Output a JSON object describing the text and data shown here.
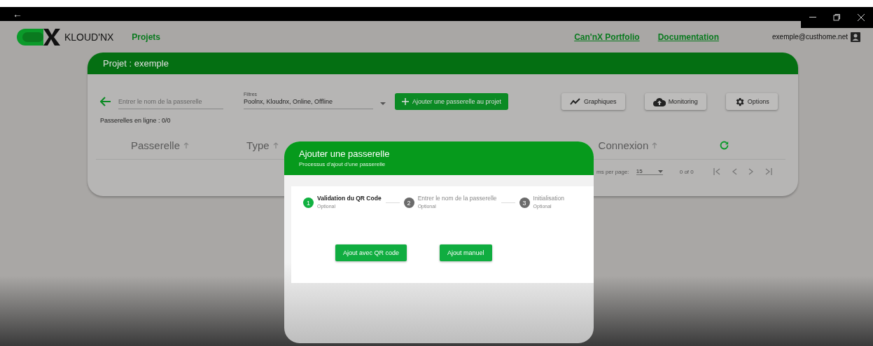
{
  "title_bar": {
    "back": "←"
  },
  "header": {
    "brand": "KLOUD'NX",
    "nav": [
      {
        "label": "Projets"
      }
    ],
    "links": [
      {
        "label": "Can'nX Portfolio"
      },
      {
        "label": "Documentation"
      }
    ],
    "user": "exemple@custhome.net"
  },
  "project": {
    "title": "Projet : exemple",
    "search": {
      "placeholder": "Entrer le nom de la passerelle"
    },
    "filter": {
      "label": "Filtres",
      "value": "Poolnx, Kloudnx, Online, Offline"
    },
    "add_button": "Ajouter une passerelle au projet",
    "tools": [
      {
        "label": "Graphiques",
        "kind": "chart"
      },
      {
        "label": "Monitoring",
        "kind": "cloud"
      },
      {
        "label": "Options",
        "kind": "gear"
      }
    ],
    "online": "Passerelles en ligne : 0/0",
    "columns": [
      {
        "label": "Passerelle"
      },
      {
        "label": "Type"
      },
      {
        "label": "Connexion"
      }
    ],
    "paginator": {
      "per_page_label": "ms per page:",
      "per_page": "15",
      "range": "0 of 0"
    }
  },
  "dialog": {
    "title": "Ajouter une passerelle",
    "subtitle": "Processus d'ajout d'une passerelle",
    "steps": [
      {
        "number": "1",
        "label": "Validation du QR Code",
        "hint": "Optional",
        "selected": true
      },
      {
        "number": "2",
        "label": "Entrer le nom de la passerelle",
        "hint": "Optional",
        "selected": false
      },
      {
        "number": "3",
        "label": "Initialisation",
        "hint": "Optional",
        "selected": false
      }
    ],
    "buttons": [
      "Ajout avec QR code",
      "Ajout manuel"
    ]
  }
}
